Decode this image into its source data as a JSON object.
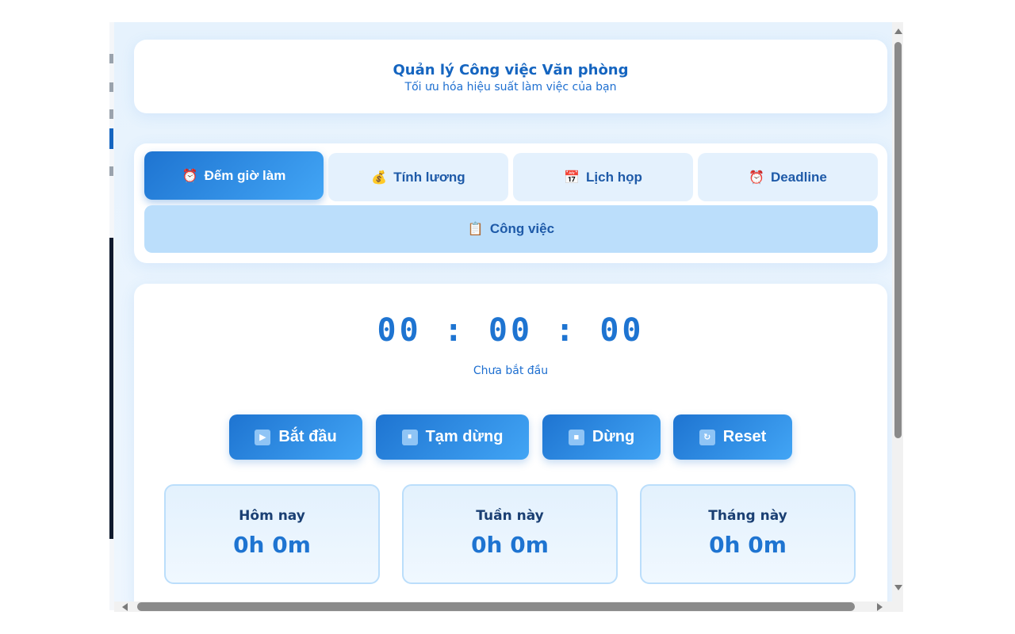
{
  "header": {
    "title": "Quản lý Công việc Văn phòng",
    "subtitle": "Tối ưu hóa hiệu suất làm việc của bạn"
  },
  "tabs": [
    {
      "label": "Đếm giờ làm",
      "icon": "⏰",
      "icon_name": "alarm-clock-icon",
      "active": true
    },
    {
      "label": "Tính lương",
      "icon": "💰",
      "icon_name": "money-bag-icon",
      "active": false
    },
    {
      "label": "Lịch họp",
      "icon": "📅",
      "icon_name": "calendar-icon",
      "active": false
    },
    {
      "label": "Deadline",
      "icon": "⏰",
      "icon_name": "alarm-clock-icon",
      "active": false
    },
    {
      "label": "Công việc",
      "icon": "📋",
      "icon_name": "clipboard-icon",
      "active": false
    }
  ],
  "timer": {
    "display": "00 : 00 : 00",
    "status": "Chưa bắt đầu"
  },
  "controls": [
    {
      "label": "Bắt đầu",
      "icon": "▶",
      "icon_name": "play-icon"
    },
    {
      "label": "Tạm dừng",
      "icon": "⏸",
      "icon_name": "pause-icon"
    },
    {
      "label": "Dừng",
      "icon": "■",
      "icon_name": "stop-icon"
    },
    {
      "label": "Reset",
      "icon": "↻",
      "icon_name": "refresh-icon"
    }
  ],
  "stats": [
    {
      "label": "Hôm nay",
      "value": "0h 0m"
    },
    {
      "label": "Tuần này",
      "value": "0h 0m"
    },
    {
      "label": "Tháng này",
      "value": "0h 0m"
    }
  ],
  "colors": {
    "primary": "#1e74d1",
    "primary_light": "#42a5f5",
    "tab_bg": "#e4f1fd",
    "tab_wide_bg": "#bbdefb",
    "page_bg": "#e6f2fd",
    "text_blue": "#1565c0"
  }
}
